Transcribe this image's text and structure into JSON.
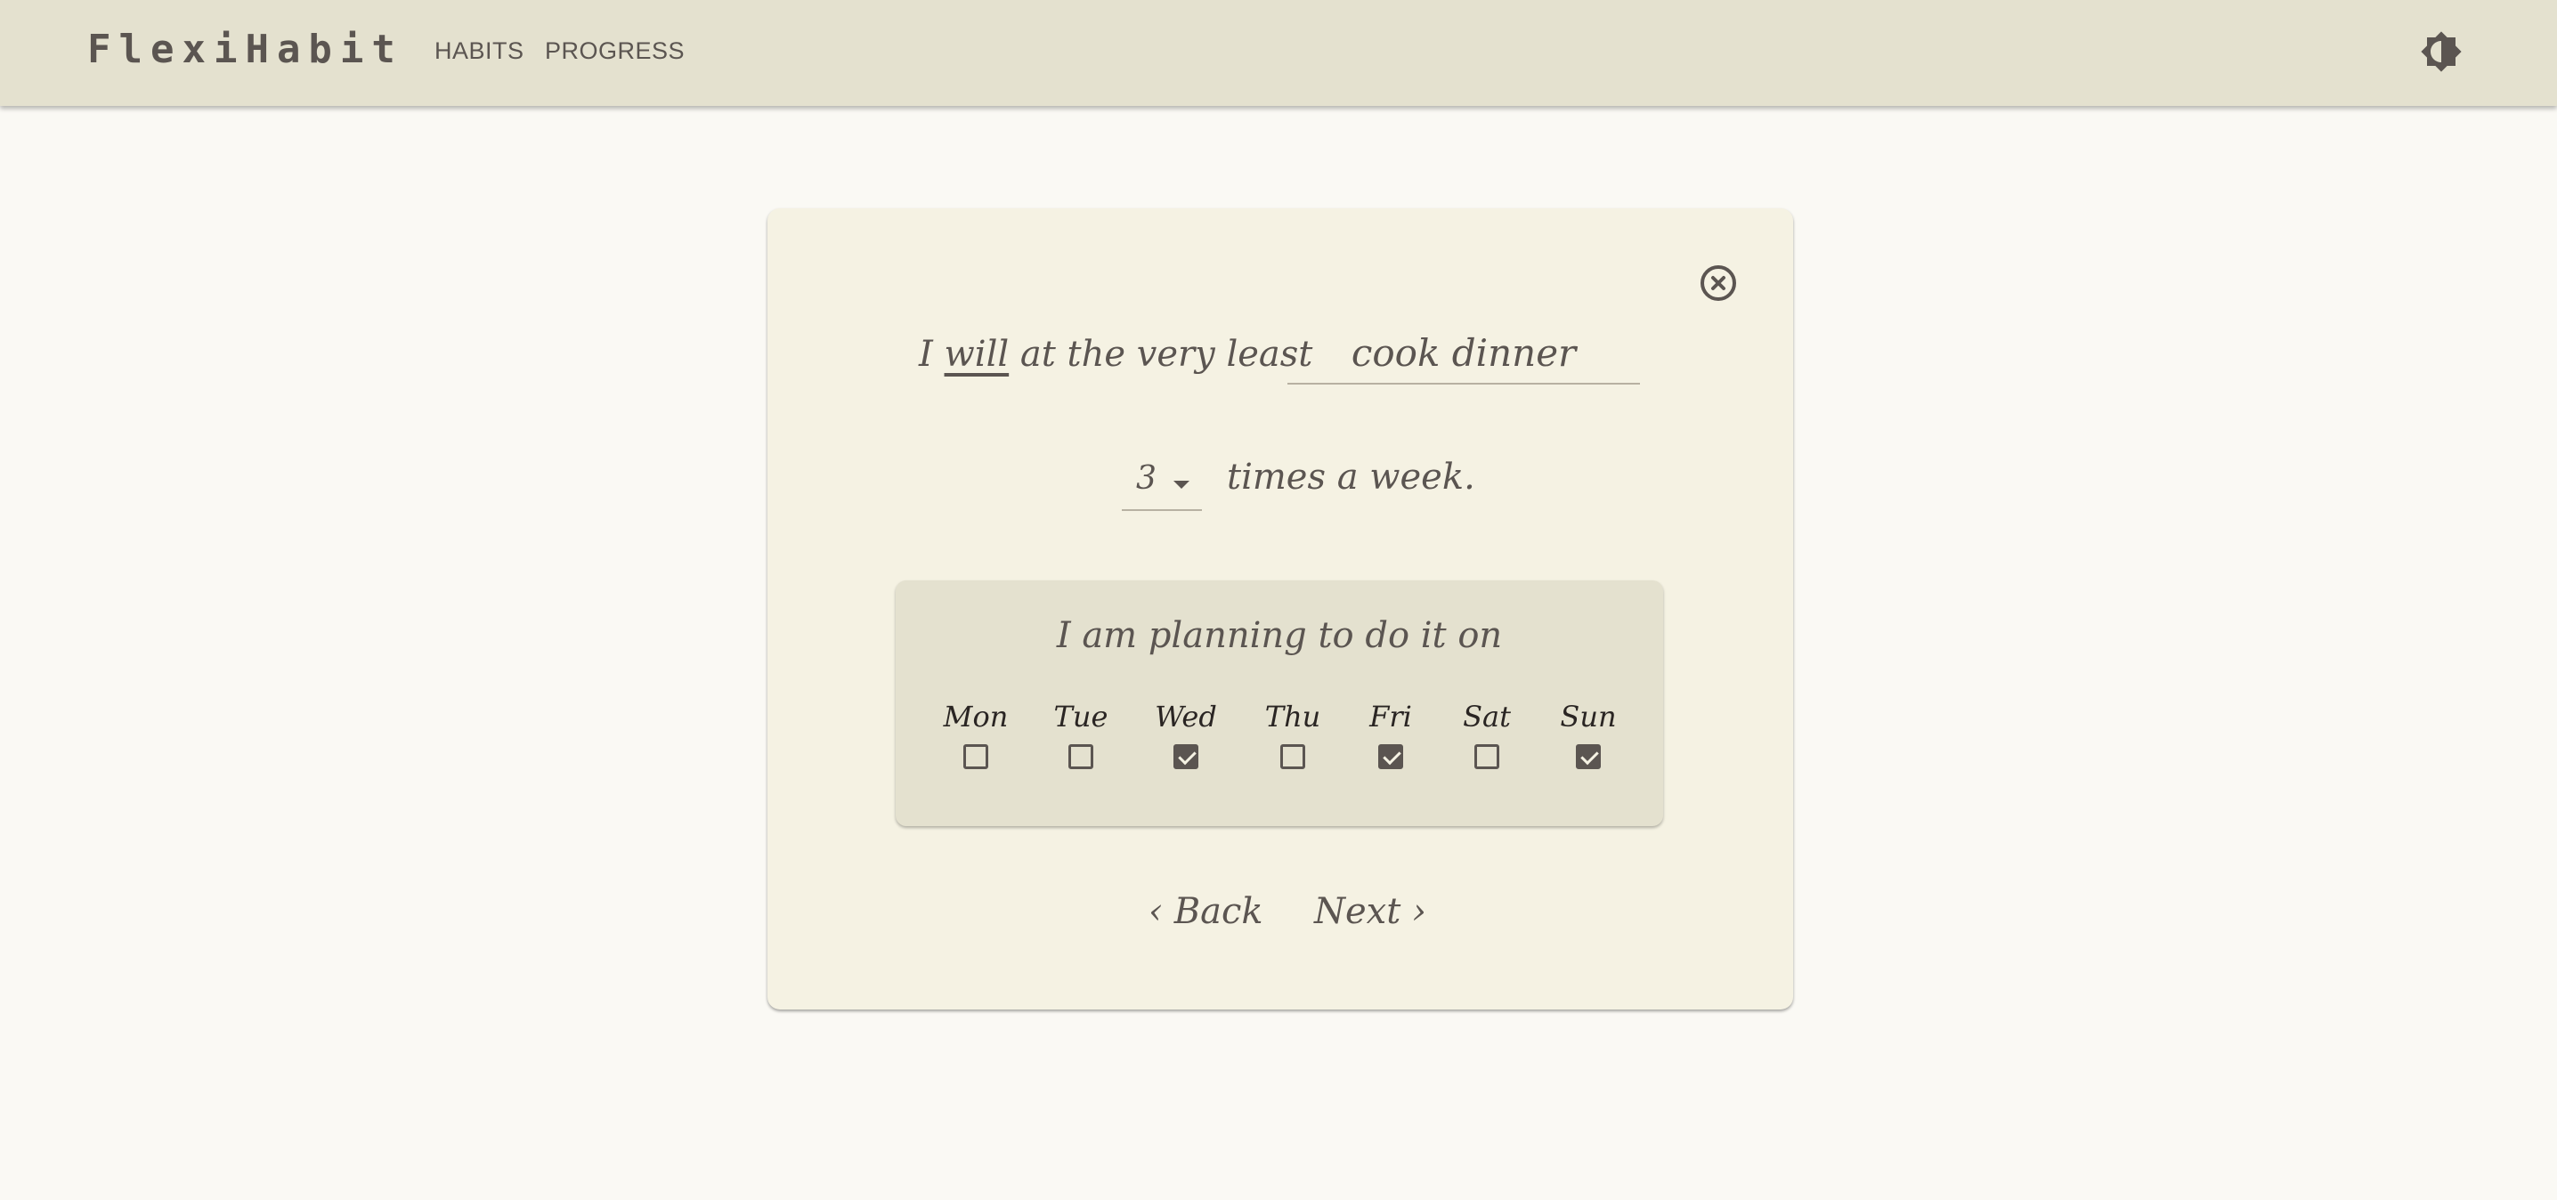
{
  "app": {
    "title": "FlexiHabit",
    "nav": {
      "habits": "HABITS",
      "progress": "PROGRESS"
    },
    "theme_toggle_icon": "brightness-icon"
  },
  "dialog": {
    "close_icon": "close-circle-icon",
    "sentence_prefix_i": "I",
    "sentence_will": "will",
    "sentence_rest": "at the very least",
    "habit_value": "cook dinner",
    "frequency": {
      "selected": "3",
      "suffix": "times a week."
    },
    "plan": {
      "title": "I am planning to do it on",
      "days": [
        {
          "label": "Mon",
          "checked": false
        },
        {
          "label": "Tue",
          "checked": false
        },
        {
          "label": "Wed",
          "checked": true
        },
        {
          "label": "Thu",
          "checked": false
        },
        {
          "label": "Fri",
          "checked": true
        },
        {
          "label": "Sat",
          "checked": false
        },
        {
          "label": "Sun",
          "checked": true
        }
      ]
    },
    "back_label": "‹ Back",
    "next_label": "Next ›"
  },
  "colors": {
    "appbar": "#e4e1cf",
    "page": "#faf9f4",
    "card": "#f5f2e3",
    "text": "#5b5551"
  }
}
